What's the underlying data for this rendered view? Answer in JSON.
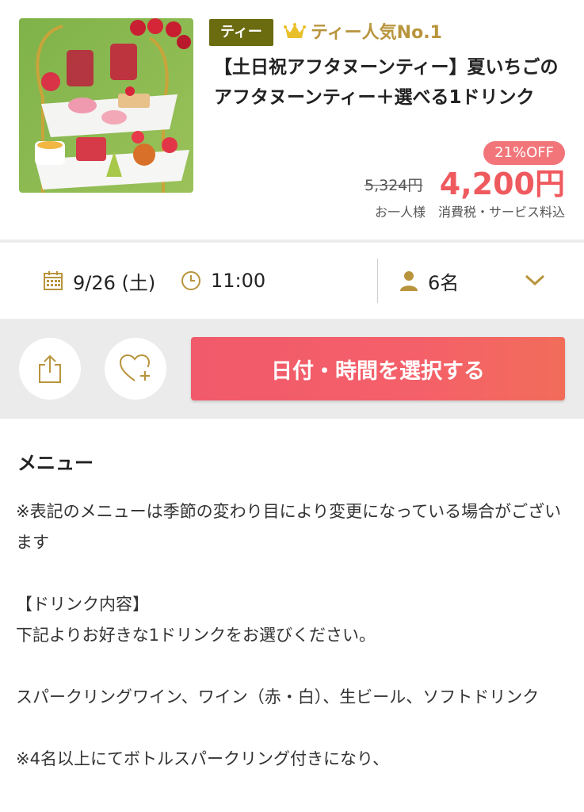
{
  "product": {
    "category_badge": "ティー",
    "rank_text": "ティー人気No.1",
    "title": "【土日祝アフタヌーンティー】夏いちごのアフタヌーンティー＋選べる1ドリンク",
    "discount": "21%OFF",
    "original_price": "5,324円",
    "price": "4,200円",
    "price_note": "お一人様　消費税・サービス料込"
  },
  "reservation": {
    "date": "9/26 (土)",
    "time": "11:00",
    "people": "6名"
  },
  "actions": {
    "select_label": "日付・時間を選択する"
  },
  "menu": {
    "heading": "メニュー",
    "lines": {
      "l1": "※表記のメニューは季節の変わり目により変更になっている場合がございます",
      "l2": "【ドリンク内容】",
      "l3": "下記よりお好きな1ドリンクをお選びください。",
      "l4": "スパークリングワイン、ワイン（赤・白）、生ビール、ソフトドリンク",
      "l5": "※4名以上にてボトルスパークリング付きになり、"
    }
  },
  "colors": {
    "accent": "#ef5a5f",
    "badge": "#6b6b10",
    "gold": "#b8943c"
  },
  "icons": {
    "calendar": "calendar-icon",
    "clock": "clock-icon",
    "person": "person-icon",
    "chevron": "chevron-down-icon",
    "share": "share-icon",
    "favorite": "heart-plus-icon",
    "crown": "crown-icon"
  }
}
